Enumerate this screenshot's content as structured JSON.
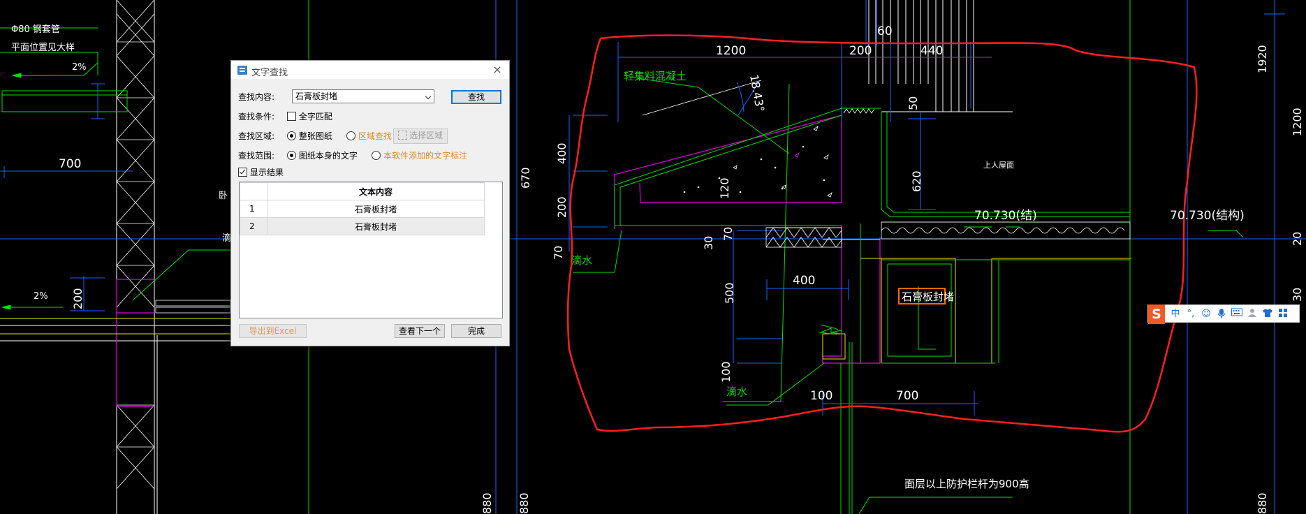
{
  "cad": {
    "labels": {
      "pipe_note": "Φ80 钢套管",
      "pipe_note_2": "平面位置见大样",
      "slope_top": "2%",
      "slope_left": "2%",
      "dim_700_left": "700",
      "dim_200_left": "200",
      "lightweight_concrete": "轻集料混凝土",
      "angle": "18.43°",
      "dim_1200": "1200",
      "dim_200_top": "200",
      "dim_440": "440",
      "dim_60": "60",
      "dim_50": "50",
      "dim_1920": "1920",
      "dim_1200_right": "1200",
      "dim_20_right": "20",
      "dim_30_right": "30",
      "dim_670": "670",
      "dim_400_v": "400",
      "dim_200_v": "200",
      "dim_120": "120",
      "dim_70_a": "70",
      "dim_30": "30",
      "dim_70_b": "70",
      "dim_620": "620",
      "roof_label": "上人屋面",
      "elev_1": "70.730(结)",
      "elev_2": "70.730(结构)",
      "drip_1": "滴水",
      "dim_400_h": "400",
      "dim_500": "500",
      "gypsum_seal": "石膏板封堵",
      "dim_100_v": "100",
      "drip_2": "滴水",
      "dim_100_h": "100",
      "dim_700": "700",
      "railing_note": "面层以上防护栏杆为900高",
      "dim_880_a": "880",
      "dim_880_b": "880",
      "dim_880_c": "880",
      "left_cut_a": "卧",
      "left_cut_b": "滴"
    }
  },
  "dialog": {
    "title": "文字查找",
    "close_glyph": "×",
    "search_content_label": "查找内容:",
    "search_value": "石膏板封堵",
    "find_button": "查找",
    "condition_label": "查找条件:",
    "full_match_label": "全字匹配",
    "full_match_checked": false,
    "area_label": "查找区域:",
    "area_whole": "整张图纸",
    "area_region": "区域查找",
    "select_area_button": "选择区域",
    "scope_label": "查找范围:",
    "scope_own": "图纸本身的文字",
    "scope_added": "本软件添加的文字标注",
    "show_results_label": "显示结果",
    "show_results_checked": true,
    "results_header": "文本内容",
    "results": [
      {
        "index": "1",
        "text": "石膏板封堵"
      },
      {
        "index": "2",
        "text": "石膏板封堵"
      }
    ],
    "export_button": "导出到Excel",
    "next_button": "查看下一个",
    "done_button": "完成"
  },
  "ime": {
    "logo": "S",
    "items": [
      "中",
      "°,",
      "☺",
      "mic-icon",
      "keyboard-icon",
      "user-icon",
      "shirt-icon",
      "grid-icon"
    ]
  },
  "colors": {
    "cad_white": "#ffffff",
    "cad_green": "#00e000",
    "cad_blue": "#1a64ff",
    "cad_magenta": "#e000e0",
    "cad_yellow": "#e8e800",
    "cad_red": "#ff2020",
    "orange_text": "#e08a2a"
  }
}
